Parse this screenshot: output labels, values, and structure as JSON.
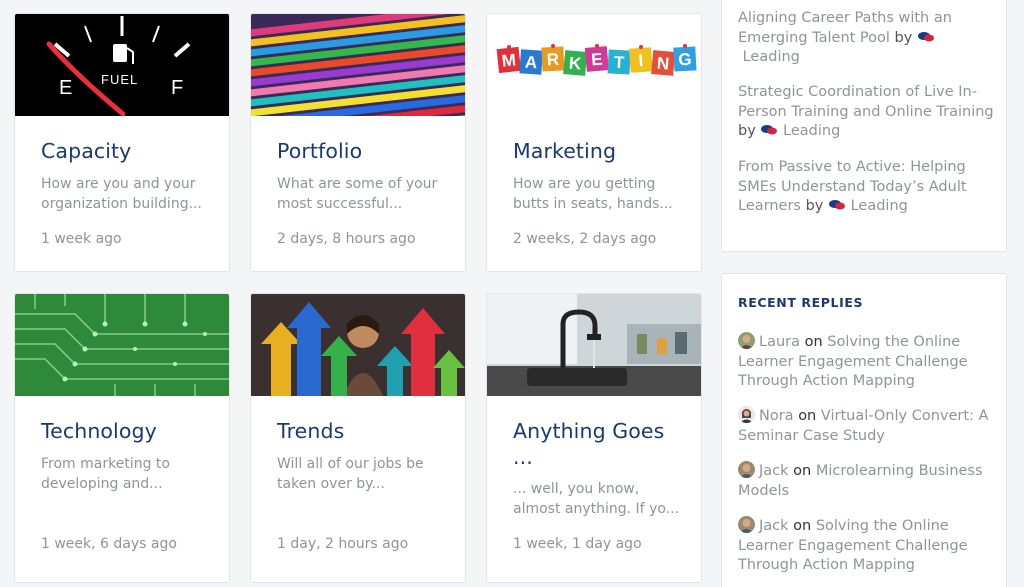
{
  "cards": [
    {
      "title": "Capacity",
      "excerpt": "How are you and your organization building...",
      "meta": "1 week ago",
      "image": "fuel-gauge"
    },
    {
      "title": "Portfolio",
      "excerpt": "What are some of your most successful...",
      "meta": "2 days, 8 hours ago",
      "image": "colorful-folders"
    },
    {
      "title": "Marketing",
      "excerpt": "How are you getting butts in seats, hands...",
      "meta": "2 weeks, 2 days ago",
      "image": "marketing-letters"
    },
    {
      "title": "Technology",
      "excerpt": "From marketing to developing and...",
      "meta": "1 week, 6 days ago",
      "image": "circuit-board"
    },
    {
      "title": "Trends",
      "excerpt": "Will all of our jobs be taken over by...",
      "meta": "1 day, 2 hours ago",
      "image": "growth-arrows"
    },
    {
      "title": "Anything Goes\n...",
      "title_line1": "Anything Goes",
      "title_line2": "...",
      "excerpt": "... well, you know, almost anything. If yo...",
      "meta": "1 week, 1 day ago",
      "image": "kitchen-faucet"
    }
  ],
  "topics": [
    {
      "line1": "Aligning Career Paths with an",
      "line2": "Emerging Talent Pool",
      "by": "by",
      "forum": "Leading"
    },
    {
      "line1": "Strategic Coordination of Live In-",
      "line2": "Person Training and Online Training",
      "by": "by",
      "forum": "Leading"
    },
    {
      "line1": "From Passive to Active: Helping",
      "line2": "SMEs Understand Today’s Adult",
      "line3": "Learners",
      "by": "by",
      "forum": "Leading"
    }
  ],
  "recent_replies": {
    "title": "RECENT REPLIES",
    "items": [
      {
        "author": "Laura",
        "on": "on",
        "topic_line1": "Solving the Online",
        "topic_line2": "Learner Engagement Challenge",
        "topic_line3": "Through Action Mapping"
      },
      {
        "author": "Nora",
        "on": "on",
        "topic_line1": "Virtual-Only Convert: A",
        "topic_line2": "Seminar Case Study"
      },
      {
        "author": "Jack",
        "on": "on",
        "topic_line1": "Microlearning Business",
        "topic_line2": "Models"
      },
      {
        "author": "Jack",
        "on": "on",
        "topic_line1": "Solving the Online",
        "topic_line2": "Learner Engagement Challenge",
        "topic_line3": "Through Action Mapping"
      }
    ]
  },
  "colors": {
    "title": "#1b3a6b",
    "muted": "#8f9498",
    "card_border": "#e3e5e8",
    "background": "#f4f5f7"
  }
}
